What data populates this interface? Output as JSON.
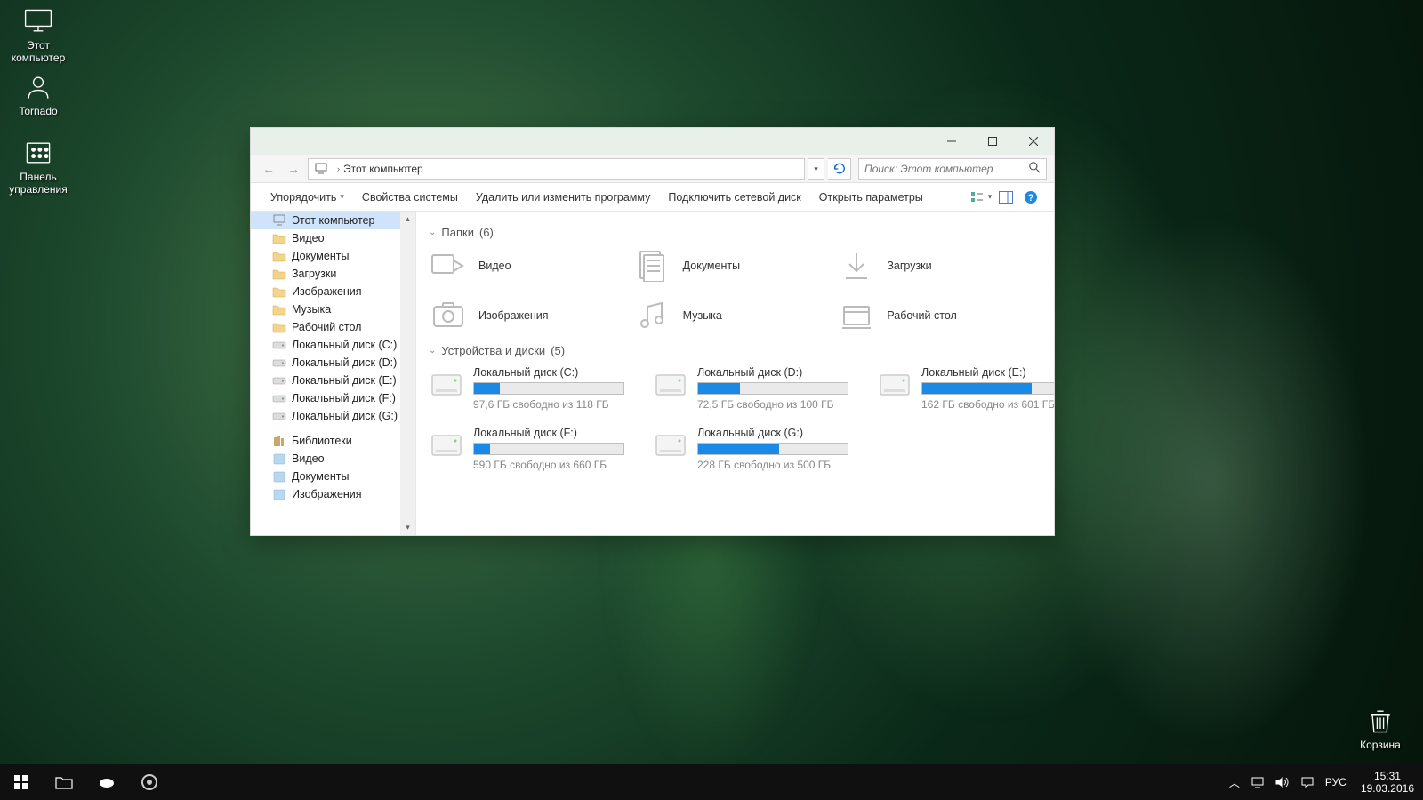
{
  "desktop": {
    "icons": [
      {
        "label": "Этот компьютер"
      },
      {
        "label": "Tornado"
      },
      {
        "label": "Панель управления"
      },
      {
        "label": "Корзина"
      }
    ]
  },
  "taskbar": {
    "time": "15:31",
    "date": "19.03.2016",
    "lang": "РУС"
  },
  "explorer": {
    "address": "Этот компьютер",
    "search_placeholder": "Поиск: Этот компьютер",
    "toolbar": {
      "organize": "Упорядочить",
      "props": "Свойства системы",
      "uninstall": "Удалить или изменить программу",
      "mapdrive": "Подключить сетевой диск",
      "settings": "Открыть параметры"
    },
    "sidebar": {
      "root": "Этот компьютер",
      "items": [
        "Видео",
        "Документы",
        "Загрузки",
        "Изображения",
        "Музыка",
        "Рабочий стол",
        "Локальный диск (C:)",
        "Локальный диск (D:)",
        "Локальный диск (E:)",
        "Локальный диск (F:)",
        "Локальный диск (G:)"
      ],
      "lib_root": "Библиотеки",
      "libs": [
        "Видео",
        "Документы",
        "Изображения"
      ]
    },
    "groups": {
      "folders_label": "Папки",
      "folders_count": "(6)",
      "drives_label": "Устройства и диски",
      "drives_count": "(5)"
    },
    "folders": [
      "Видео",
      "Документы",
      "Загрузки",
      "Изображения",
      "Музыка",
      "Рабочий стол"
    ],
    "drives": [
      {
        "name": "Локальный диск (C:)",
        "free": "97,6 ГБ свободно из 118 ГБ",
        "pct": 17
      },
      {
        "name": "Локальный диск (D:)",
        "free": "72,5 ГБ свободно из 100 ГБ",
        "pct": 28
      },
      {
        "name": "Локальный диск (E:)",
        "free": "162 ГБ свободно из 601 ГБ",
        "pct": 73
      },
      {
        "name": "Локальный диск (F:)",
        "free": "590 ГБ свободно из 660 ГБ",
        "pct": 11
      },
      {
        "name": "Локальный диск (G:)",
        "free": "228 ГБ свободно из 500 ГБ",
        "pct": 54
      }
    ]
  }
}
